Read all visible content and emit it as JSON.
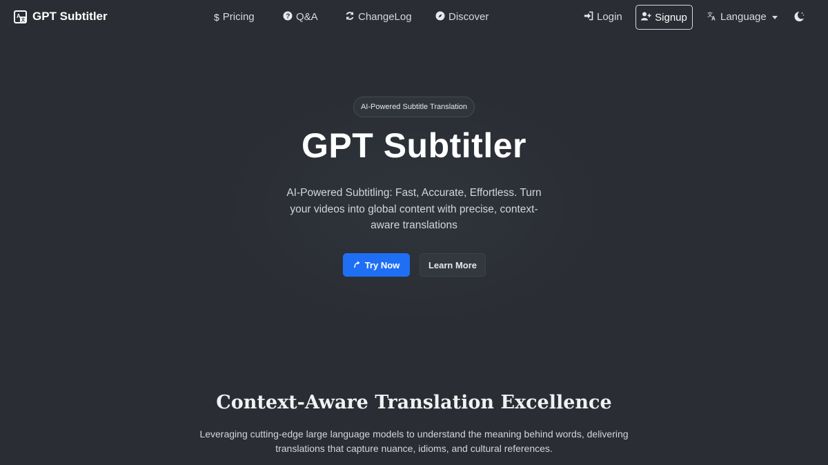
{
  "brand": {
    "name": "GPT Subtitler",
    "icon": "translate-box-icon"
  },
  "nav": {
    "pricing": {
      "label": "Pricing",
      "icon": "dollar-icon"
    },
    "qa": {
      "label": "Q&A",
      "icon": "question-circle-icon"
    },
    "changelog": {
      "label": "ChangeLog",
      "icon": "refresh-icon"
    },
    "discover": {
      "label": "Discover",
      "icon": "compass-icon"
    },
    "login": {
      "label": "Login",
      "icon": "login-arrow-icon"
    },
    "signup": {
      "label": "Signup",
      "icon": "user-plus-icon"
    },
    "language": {
      "label": "Language",
      "icon": "translate-icon"
    },
    "theme_toggle": {
      "icon": "moon-stars-icon"
    }
  },
  "hero": {
    "badge": "AI-Powered Subtitle Translation",
    "title": "GPT Subtitler",
    "subtitle": "AI-Powered Subtitling: Fast, Accurate, Effortless. Turn your videos into global content with precise, context-aware translations",
    "primary_button": "Try Now",
    "secondary_button": "Learn More"
  },
  "section": {
    "title": "Context-Aware Translation Excellence",
    "text": "Leveraging cutting-edge large language models to understand the meaning behind words, delivering translations that capture nuance, idioms, and cultural references."
  },
  "colors": {
    "background": "#2a2d33",
    "primary": "#1f6ff5",
    "text": "#e6e8eb"
  }
}
